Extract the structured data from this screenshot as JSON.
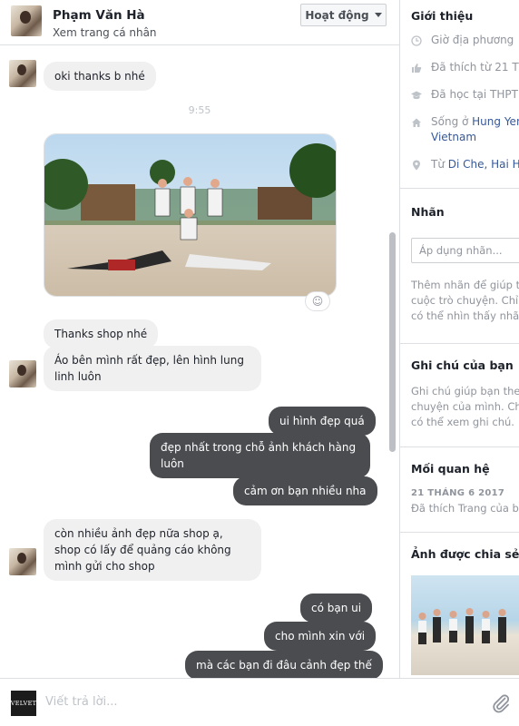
{
  "header": {
    "name": "Phạm Văn Hà",
    "subtitle": "Xem trang cá nhân",
    "status_button": "Hoạt động"
  },
  "messages": [
    {
      "text": "oki thanks b nhé",
      "from": "them"
    },
    {
      "time": "9:55"
    },
    {
      "image": "beach-group-photo",
      "from": "them"
    },
    {
      "text": "Thanks shop nhé",
      "from": "them"
    },
    {
      "text": "Áo bên mình rất đẹp, lên hình lung linh luôn",
      "from": "them"
    },
    {
      "text": "ui hình đẹp quá",
      "from": "me"
    },
    {
      "text": "đẹp nhất trong chỗ ảnh khách hàng luôn",
      "from": "me"
    },
    {
      "text": "cảm ơn bạn nhiều nha",
      "from": "me"
    },
    {
      "text": "còn nhiều ảnh đẹp nữa shop ạ, shop có lấy để quảng cáo không mình gửi cho shop",
      "from": "them"
    },
    {
      "text": "có bạn ui",
      "from": "me"
    },
    {
      "text": "cho mình xin với",
      "from": "me"
    },
    {
      "text": "mà các bạn đi đâu cảnh đẹp thế",
      "from": "me"
    }
  ],
  "composer": {
    "placeholder": "Viết trả lời...",
    "page_logo": "VELVET"
  },
  "panel": {
    "intro_title": "Giới thiệu",
    "intro_items": [
      {
        "icon": "clock-icon",
        "text": "Giờ địa phương"
      },
      {
        "icon": "like-icon",
        "text": "Đã thích từ 21 Th"
      },
      {
        "icon": "graduation-cap-icon",
        "text": "Đã học tại THPT"
      },
      {
        "icon": "home-icon",
        "text_prefix": "Sống ở ",
        "link1": "Hung Yen",
        "link2": "Vietnam"
      },
      {
        "icon": "location-pin-icon",
        "text_prefix": "Từ ",
        "link1": "Di Che, Hai H"
      }
    ],
    "labels_title": "Nhãn",
    "labels_placeholder": "Áp dụng nhãn...",
    "labels_help": [
      "Thêm nhãn để giúp th",
      "cuộc trò chuyện. Chỉ",
      "có thể nhìn thấy nhãn"
    ],
    "notes_title": "Ghi chú của bạn",
    "notes_help": [
      "Ghi chú giúp bạn theo",
      "chuyện của mình. Ch",
      "có thể xem ghi chú."
    ],
    "relationship_title": "Mối quan hệ",
    "relationship_date": "21 THÁNG 6 2017",
    "relationship_text": "Đã thích Trang của ba",
    "shared_title": "Ảnh được chia sẻ"
  },
  "colors": {
    "outgoing_bubble": "#4a4c50",
    "incoming_bubble": "#f1f0f0",
    "link": "#365899"
  }
}
